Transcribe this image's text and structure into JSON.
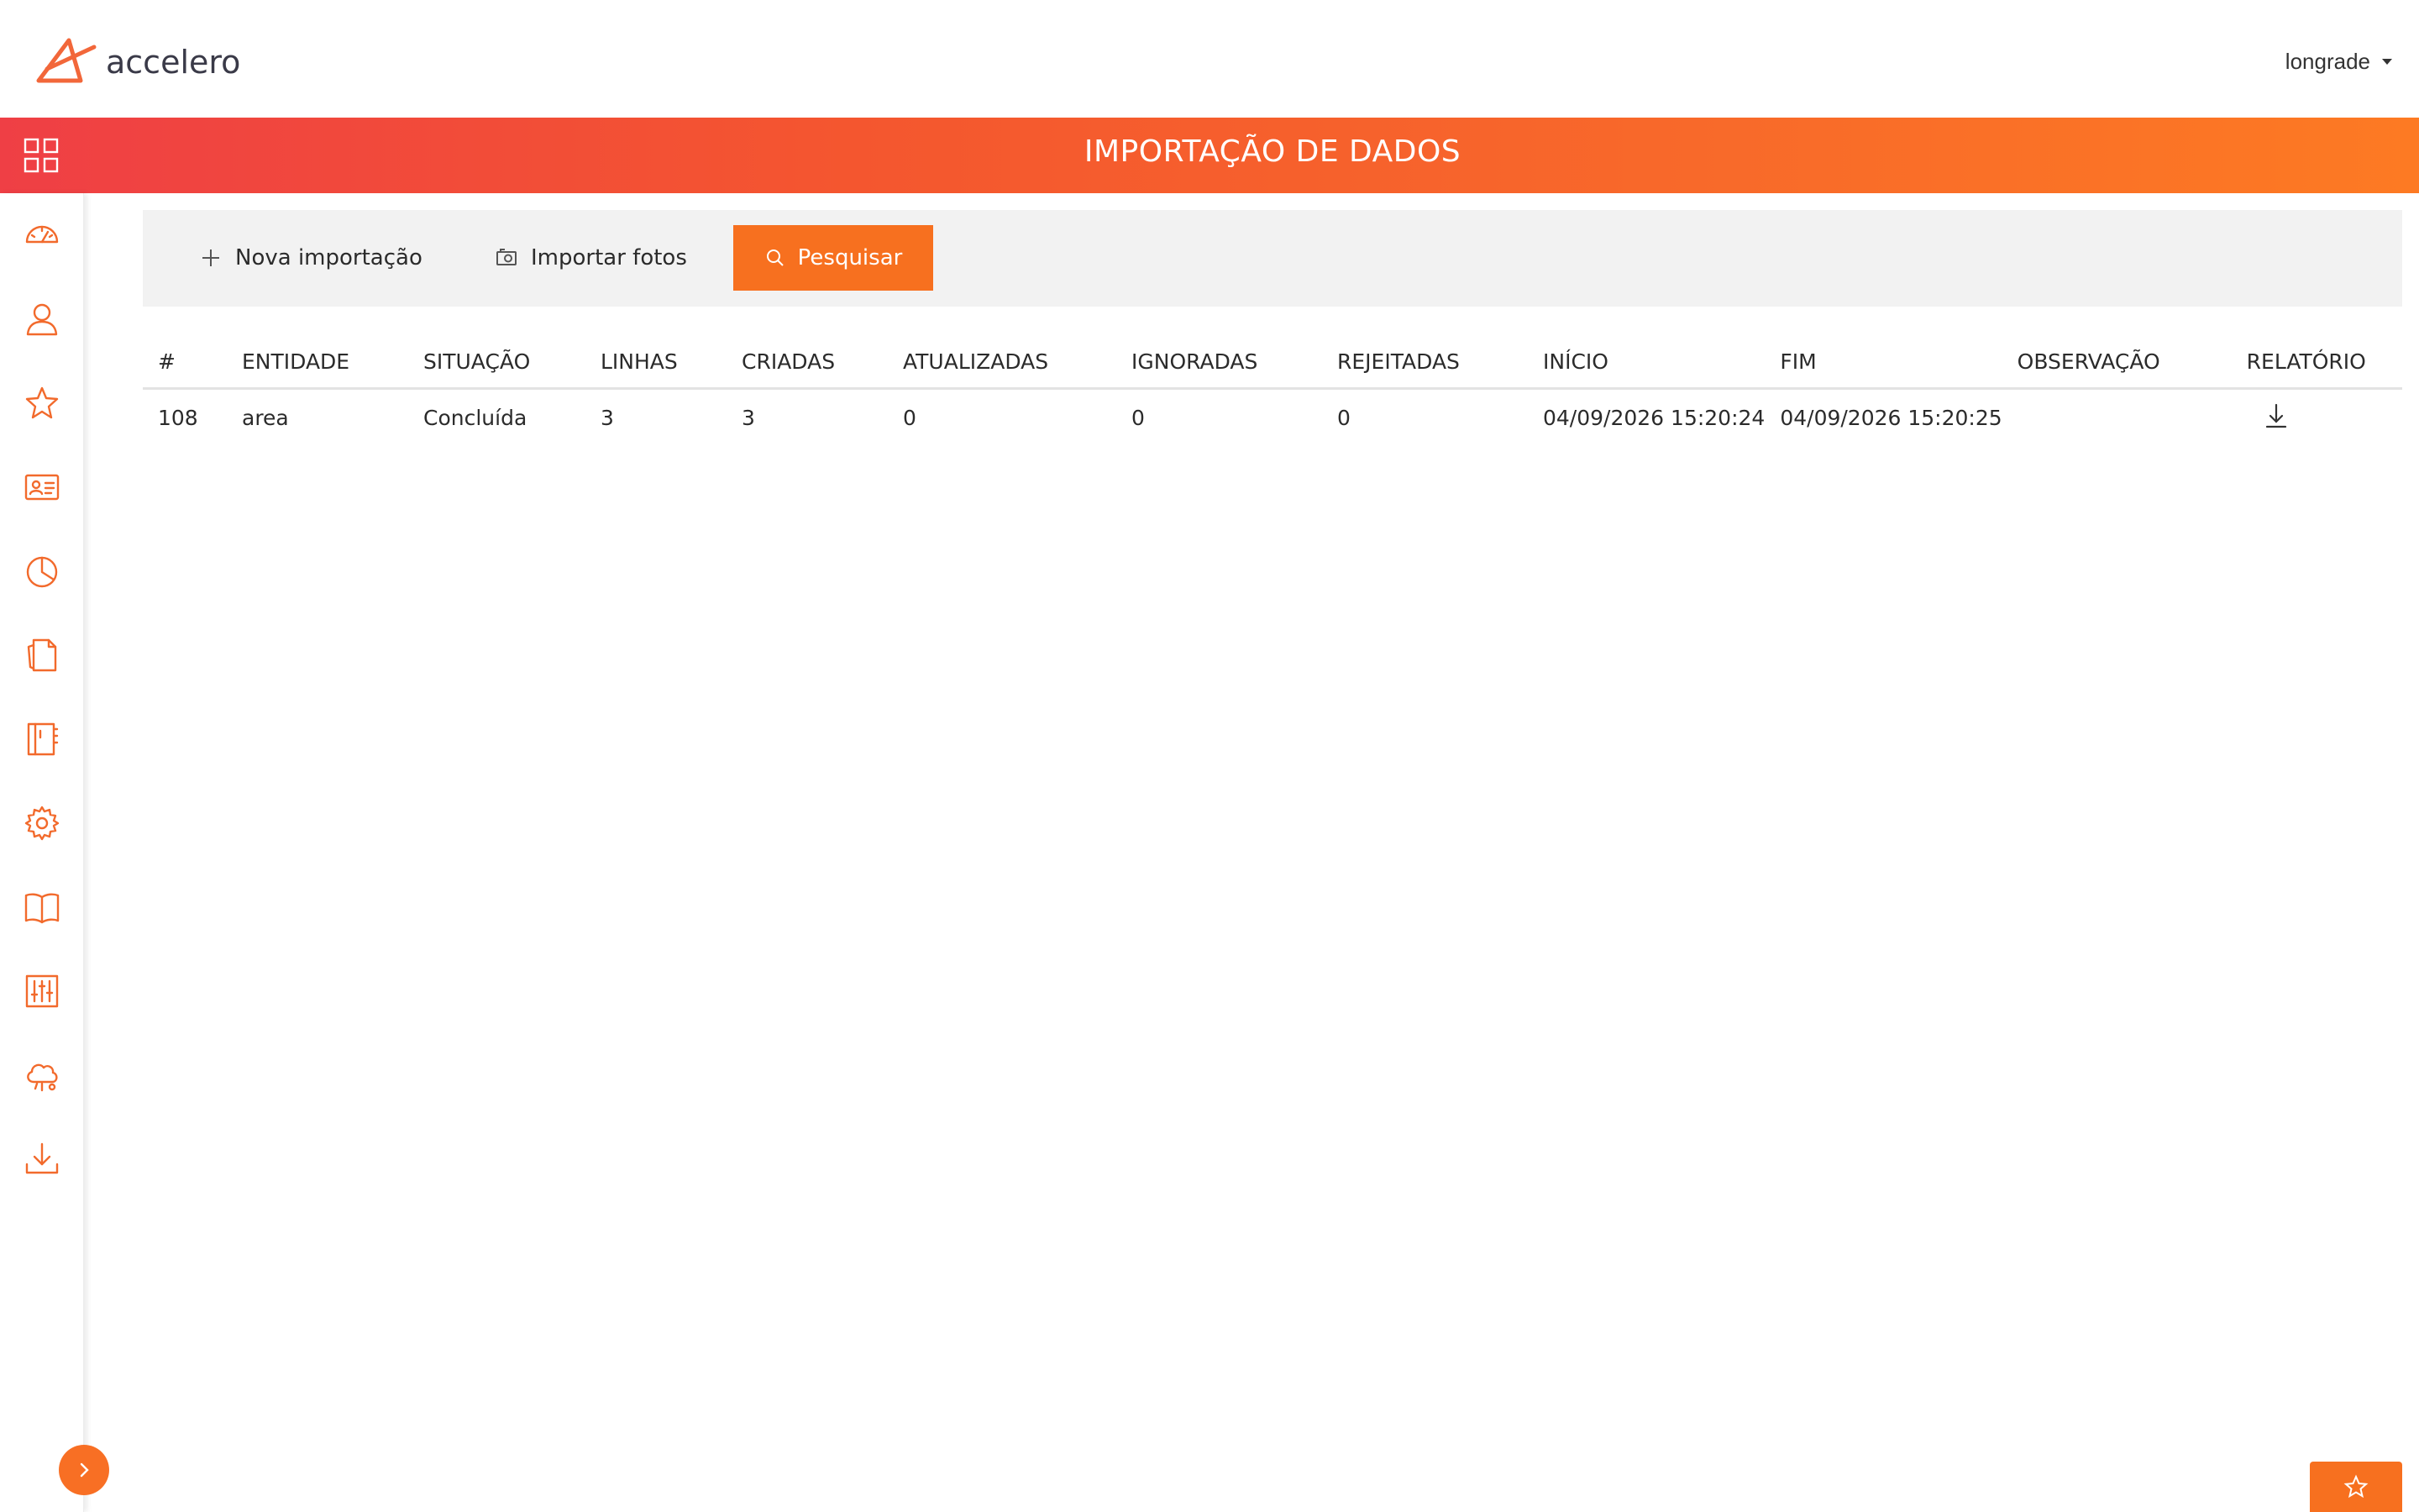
{
  "header": {
    "logo_text": "accelero",
    "user_name": "longrade"
  },
  "banner": {
    "title": "IMPORTAÇÃO DE DADOS",
    "gradient_start": "#ef3f45",
    "gradient_end": "#fd7a23"
  },
  "sidebar": {
    "accent_color": "#f26a2c",
    "icons": [
      "dashboard-gauge-icon",
      "user-icon",
      "star-icon",
      "id-card-icon",
      "pie-chart-icon",
      "documents-icon",
      "notebook-icon",
      "gear-icon",
      "book-icon",
      "sliders-icon",
      "cloud-settings-icon",
      "download-icon"
    ]
  },
  "toolbar": {
    "new_import_label": "Nova importação",
    "import_photos_label": "Importar fotos",
    "search_label": "Pesquisar",
    "accent_color": "#f7701f"
  },
  "table": {
    "columns": [
      "#",
      "ENTIDADE",
      "SITUAÇÃO",
      "LINHAS",
      "CRIADAS",
      "ATUALIZADAS",
      "IGNORADAS",
      "REJEITADAS",
      "INÍCIO",
      "FIM",
      "OBSERVAÇÃO",
      "RELATÓRIO"
    ],
    "rows": [
      {
        "id": "108",
        "entidade": "area",
        "situacao": "Concluída",
        "linhas": "3",
        "criadas": "3",
        "atualizadas": "0",
        "ignoradas": "0",
        "rejeitadas": "0",
        "inicio": "04/09/2026 15:20:24",
        "fim": "04/09/2026 15:20:25",
        "observacao": "",
        "relatorio_icon": "download-icon"
      }
    ]
  }
}
